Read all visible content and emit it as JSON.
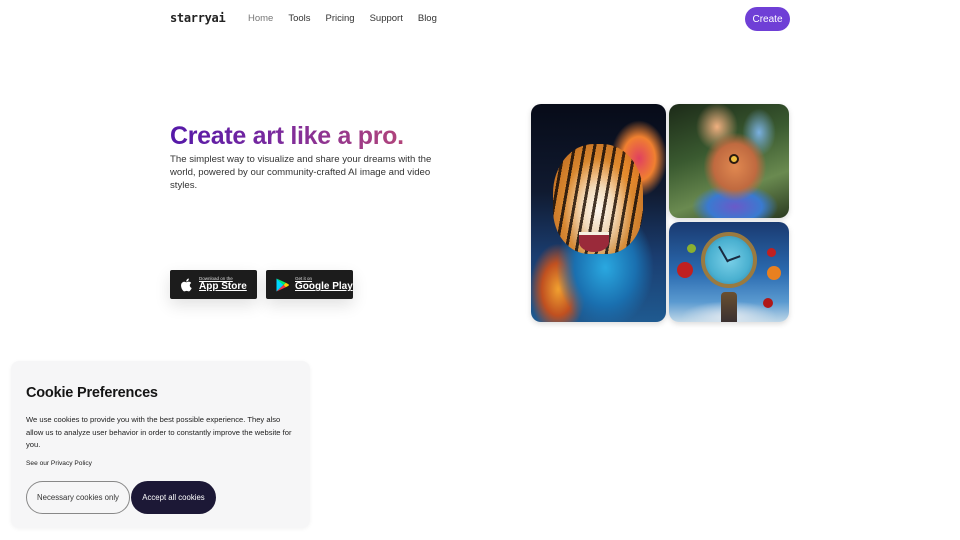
{
  "header": {
    "logo": "starryai",
    "nav": [
      {
        "label": "Home",
        "active": true
      },
      {
        "label": "Tools",
        "active": false
      },
      {
        "label": "Pricing",
        "active": false
      },
      {
        "label": "Support",
        "active": false
      },
      {
        "label": "Blog",
        "active": false
      }
    ],
    "create_label": "Create",
    "accent_color": "#6f3fd6"
  },
  "hero": {
    "title": "Create art like a pro.",
    "subtitle": "The simplest way to visualize and share your dreams with the world, powered by our community-crafted AI image and video styles.",
    "title_gradient": [
      "#5418a8",
      "#b2457a"
    ],
    "app_store": {
      "small": "Download on the",
      "big": "App Store",
      "icon": "apple-icon"
    },
    "google_play": {
      "small": "Get it on",
      "big": "Google Play",
      "icon": "google-play-icon"
    }
  },
  "gallery": [
    {
      "name": "tiger-artwork",
      "description": "Tiger with colorful paint splash"
    },
    {
      "name": "bird-artwork",
      "description": "Colorful feathered bird in forest"
    },
    {
      "name": "clock-artwork",
      "description": "Surreal clock with floating apples"
    }
  ],
  "cookie": {
    "title": "Cookie Preferences",
    "text": "We use cookies to provide you with the best possible experience. They also allow us to analyze user behavior in order to constantly improve the website for you.",
    "privacy_link": "See our Privacy Policy",
    "necessary_label": "Necessary cookies only",
    "accept_label": "Accept all cookies"
  }
}
